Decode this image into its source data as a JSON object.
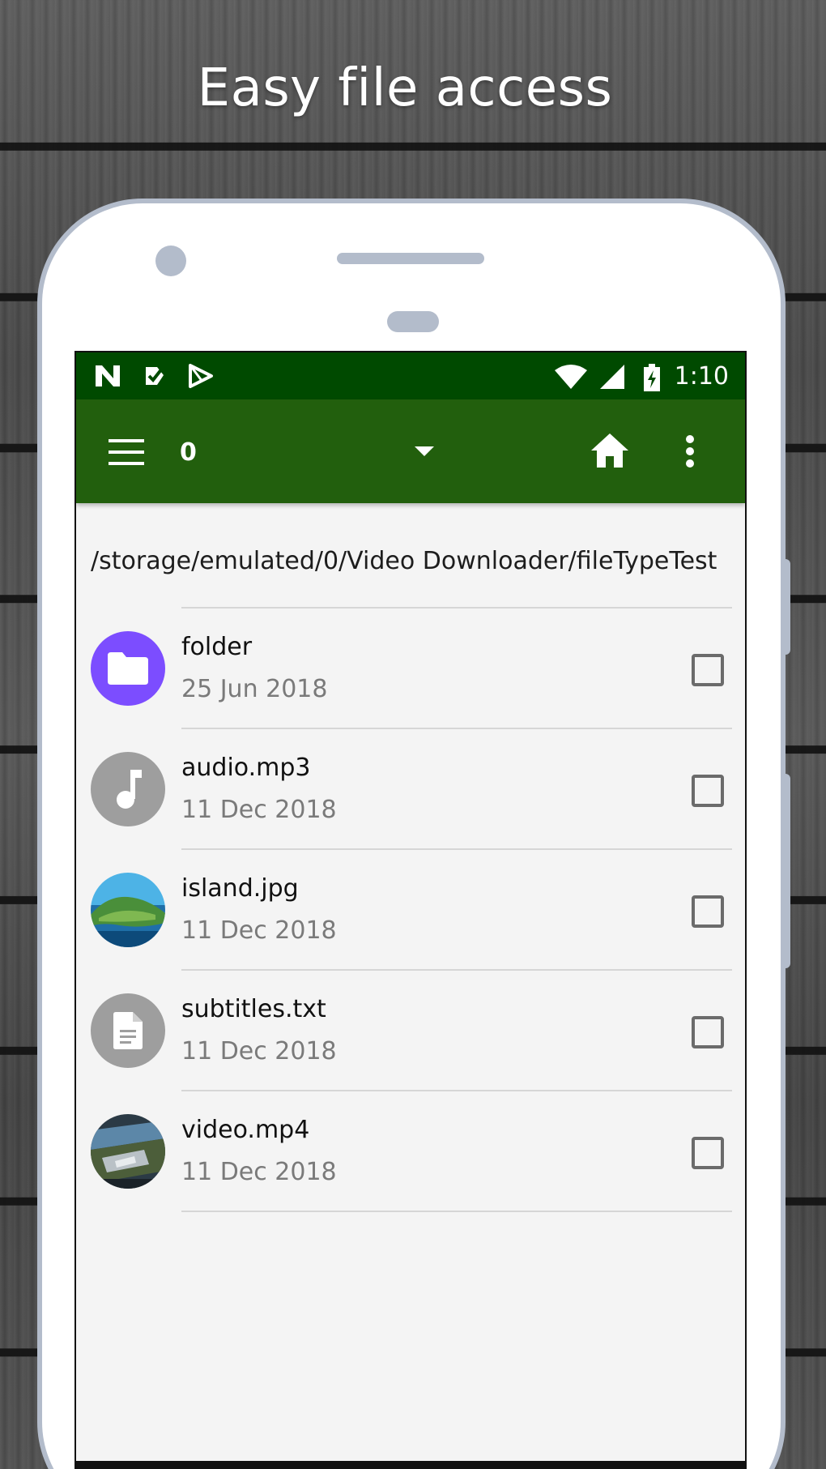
{
  "headline": "Easy file access",
  "statusbar": {
    "time": "1:10",
    "left_icons": [
      "n-notification-icon",
      "checkbox-notification-icon",
      "play-store-icon"
    ],
    "right_icons": [
      "wifi-icon",
      "signal-icon",
      "battery-charging-icon"
    ]
  },
  "toolbar": {
    "title": "0",
    "menu_icon": "hamburger-menu-icon",
    "dropdown_icon": "dropdown-arrow-icon",
    "home_icon": "home-icon",
    "more_icon": "more-vertical-icon"
  },
  "path": "/storage/emulated/0/Video Downloader/fileTypeTest",
  "files": [
    {
      "name": "folder",
      "date": "25 Jun 2018",
      "icon": "folder-icon"
    },
    {
      "name": "audio.mp3",
      "date": "11 Dec 2018",
      "icon": "music-note-icon"
    },
    {
      "name": "island.jpg",
      "date": "11 Dec 2018",
      "icon": "image-thumbnail"
    },
    {
      "name": "subtitles.txt",
      "date": "11 Dec 2018",
      "icon": "document-icon"
    },
    {
      "name": "video.mp4",
      "date": "11 Dec 2018",
      "icon": "video-thumbnail"
    }
  ],
  "colors": {
    "statusbar": "#004a00",
    "toolbar": "#225f0d",
    "folder_avatar": "#7c4dff",
    "grey_avatar": "#9e9e9e"
  }
}
